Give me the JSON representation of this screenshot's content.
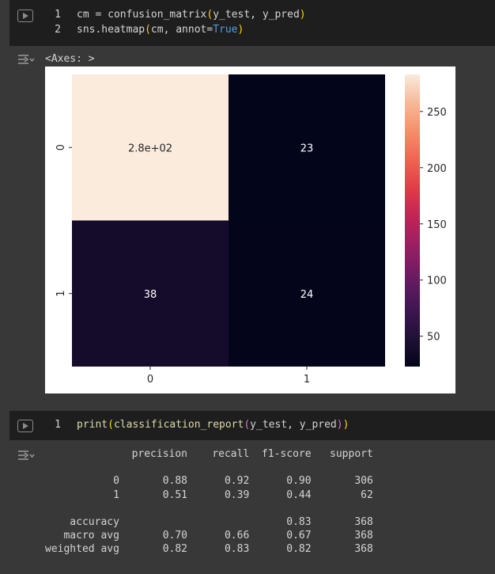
{
  "cell1": {
    "lines": [
      {
        "num": "1",
        "parts": [
          {
            "t": "cm = ",
            "c": "pl"
          },
          {
            "t": "confusion_matrix",
            "c": "pl"
          },
          {
            "t": "(",
            "c": "pn"
          },
          {
            "t": "y_test, y_pred",
            "c": "pl"
          },
          {
            "t": ")",
            "c": "pn"
          }
        ]
      },
      {
        "num": "2",
        "parts": [
          {
            "t": "sns.heatmap",
            "c": "pl"
          },
          {
            "t": "(",
            "c": "pn"
          },
          {
            "t": "cm, annot=",
            "c": "pl"
          },
          {
            "t": "True",
            "c": "kw"
          },
          {
            "t": ")",
            "c": "pn"
          }
        ]
      }
    ]
  },
  "output1": {
    "text": "<Axes: >"
  },
  "chart_data": {
    "type": "heatmap",
    "x_tick_labels": [
      "0",
      "1"
    ],
    "y_tick_labels": [
      "0",
      "1"
    ],
    "values": [
      [
        283,
        23
      ],
      [
        38,
        24
      ]
    ],
    "annotations": [
      [
        "2.8e+02",
        "23"
      ],
      [
        "38",
        "24"
      ]
    ],
    "colorbar": {
      "min": 23,
      "max": 283,
      "ticks": [
        50,
        100,
        150,
        200,
        250
      ]
    },
    "colormap": "rocket"
  },
  "cell2": {
    "lines": [
      {
        "num": "1",
        "parts": [
          {
            "t": "print",
            "c": "fn"
          },
          {
            "t": "(",
            "c": "pn"
          },
          {
            "t": "classification_report",
            "c": "fn"
          },
          {
            "t": "(",
            "c": "pn2"
          },
          {
            "t": "y_test, y_pred",
            "c": "pl"
          },
          {
            "t": ")",
            "c": "pn2"
          },
          {
            "t": ")",
            "c": "pn"
          }
        ]
      }
    ]
  },
  "report": {
    "text": "              precision    recall  f1-score   support\n\n           0       0.88      0.92      0.90       306\n           1       0.51      0.39      0.44        62\n\n    accuracy                           0.83       368\n   macro avg       0.70      0.66      0.67       368\nweighted avg       0.82      0.83      0.82       368"
  }
}
